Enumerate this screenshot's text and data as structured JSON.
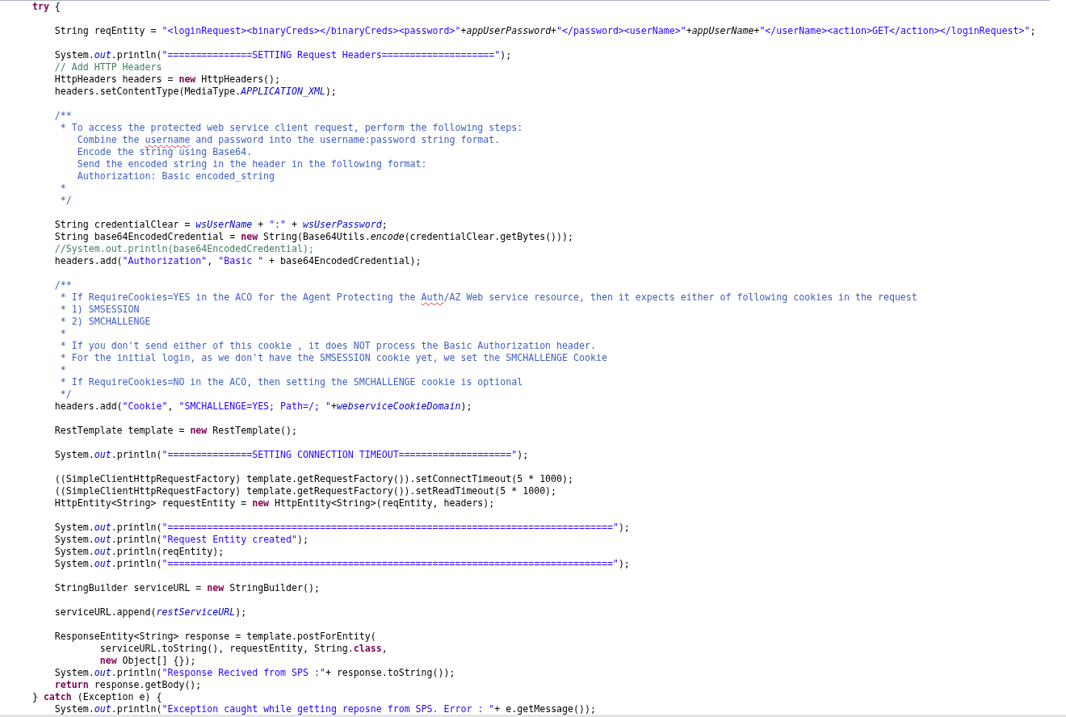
{
  "editor": {
    "lines": [
      {
        "kind": "code",
        "tokens": [
          {
            "kind": "keyword",
            "text": "    try"
          },
          {
            "kind": "plain",
            "text": " {"
          }
        ]
      },
      {
        "kind": "blank"
      },
      {
        "kind": "code",
        "tokens": [
          {
            "kind": "plain",
            "text": "        String reqEntity = "
          },
          {
            "kind": "string",
            "text": "\"<loginRequest><binaryCreds></binaryCreds><password>\""
          },
          {
            "kind": "plain",
            "text": "+"
          },
          {
            "kind": "italic",
            "text": "appUserPassword"
          },
          {
            "kind": "plain",
            "text": "+"
          },
          {
            "kind": "string",
            "text": "\"</password><userName>\""
          },
          {
            "kind": "plain",
            "text": "+"
          },
          {
            "kind": "italic",
            "text": "appUserName"
          },
          {
            "kind": "plain",
            "text": "+"
          },
          {
            "kind": "string",
            "text": "\"</userName><action>GET</action></loginRequest>\""
          },
          {
            "kind": "plain",
            "text": ";"
          }
        ]
      },
      {
        "kind": "blank"
      },
      {
        "kind": "code",
        "tokens": [
          {
            "kind": "plain",
            "text": "        System."
          },
          {
            "kind": "field",
            "text": "out"
          },
          {
            "kind": "plain",
            "text": ".println("
          },
          {
            "kind": "string",
            "text": "\"===============SETTING Request Headers====================\""
          },
          {
            "kind": "plain",
            "text": ");"
          }
        ]
      },
      {
        "kind": "code",
        "tokens": [
          {
            "kind": "comment",
            "text": "        // Add HTTP Headers"
          }
        ]
      },
      {
        "kind": "code",
        "tokens": [
          {
            "kind": "plain",
            "text": "        HttpHeaders headers = "
          },
          {
            "kind": "keyword",
            "text": "new"
          },
          {
            "kind": "plain",
            "text": " HttpHeaders();"
          }
        ]
      },
      {
        "kind": "code",
        "tokens": [
          {
            "kind": "plain",
            "text": "        headers.setContentType(MediaType."
          },
          {
            "kind": "field",
            "text": "APPLICATION_XML"
          },
          {
            "kind": "plain",
            "text": ");"
          }
        ]
      },
      {
        "kind": "blank"
      },
      {
        "kind": "code",
        "tokens": [
          {
            "kind": "javadoc",
            "text": "        /**"
          }
        ]
      },
      {
        "kind": "code",
        "tokens": [
          {
            "kind": "javadoc",
            "text": "         * To access the protected web service client request, perform the following steps:"
          }
        ]
      },
      {
        "kind": "code",
        "tokens": [
          {
            "kind": "javadoc",
            "text": "            Combine the "
          },
          {
            "kind": "typo",
            "text": "username"
          },
          {
            "kind": "javadoc",
            "text": " and password into the username:password string format."
          }
        ]
      },
      {
        "kind": "code",
        "tokens": [
          {
            "kind": "javadoc",
            "text": "            Encode the string using Base64."
          }
        ]
      },
      {
        "kind": "code",
        "tokens": [
          {
            "kind": "javadoc",
            "text": "            Send the encoded string in the header in the following format:"
          }
        ]
      },
      {
        "kind": "code",
        "tokens": [
          {
            "kind": "javadoc",
            "text": "            Authorization: Basic encoded_string"
          }
        ]
      },
      {
        "kind": "code",
        "tokens": [
          {
            "kind": "javadoc",
            "text": "         *"
          }
        ]
      },
      {
        "kind": "code",
        "tokens": [
          {
            "kind": "javadoc",
            "text": "         */"
          }
        ]
      },
      {
        "kind": "blank"
      },
      {
        "kind": "code",
        "tokens": [
          {
            "kind": "plain",
            "text": "        String credentialClear = "
          },
          {
            "kind": "field",
            "text": "wsUserName"
          },
          {
            "kind": "plain",
            "text": " + "
          },
          {
            "kind": "string",
            "text": "\":\""
          },
          {
            "kind": "plain",
            "text": " + "
          },
          {
            "kind": "field",
            "text": "wsUserPassword"
          },
          {
            "kind": "plain",
            "text": ";"
          }
        ]
      },
      {
        "kind": "code",
        "tokens": [
          {
            "kind": "plain",
            "text": "        String base64EncodedCredential = "
          },
          {
            "kind": "keyword",
            "text": "new"
          },
          {
            "kind": "plain",
            "text": " String(Base64Utils."
          },
          {
            "kind": "italic",
            "text": "encode"
          },
          {
            "kind": "plain",
            "text": "(credentialClear.getBytes()));"
          }
        ]
      },
      {
        "kind": "code",
        "tokens": [
          {
            "kind": "comment",
            "text": "        //System.out.println(base64EncodedCredential);"
          }
        ]
      },
      {
        "kind": "code",
        "tokens": [
          {
            "kind": "plain",
            "text": "        headers.add("
          },
          {
            "kind": "string",
            "text": "\"Authorization\""
          },
          {
            "kind": "plain",
            "text": ", "
          },
          {
            "kind": "string",
            "text": "\"Basic \""
          },
          {
            "kind": "plain",
            "text": " + base64EncodedCredential);"
          }
        ]
      },
      {
        "kind": "blank"
      },
      {
        "kind": "code",
        "tokens": [
          {
            "kind": "javadoc",
            "text": "        /**"
          }
        ]
      },
      {
        "kind": "code",
        "tokens": [
          {
            "kind": "javadoc",
            "text": "         * If RequireCookies=YES in the ACO for the Agent Protecting the "
          },
          {
            "kind": "typo",
            "text": "Auth"
          },
          {
            "kind": "javadoc",
            "text": "/AZ Web service resource, then it expects either of following cookies in the request"
          }
        ]
      },
      {
        "kind": "code",
        "tokens": [
          {
            "kind": "javadoc",
            "text": "         * 1) SMSESSION"
          }
        ]
      },
      {
        "kind": "code",
        "tokens": [
          {
            "kind": "javadoc",
            "text": "         * 2) SMCHALLENGE"
          }
        ]
      },
      {
        "kind": "code",
        "tokens": [
          {
            "kind": "javadoc",
            "text": "         *"
          }
        ]
      },
      {
        "kind": "code",
        "tokens": [
          {
            "kind": "javadoc",
            "text": "         * If you don't send either of this cookie , it does NOT process the Basic Authorization header."
          }
        ]
      },
      {
        "kind": "code",
        "tokens": [
          {
            "kind": "javadoc",
            "text": "         * For the initial login, as we don't have the SMSESSION cookie yet, we set the SMCHALLENGE Cookie"
          }
        ]
      },
      {
        "kind": "code",
        "tokens": [
          {
            "kind": "javadoc",
            "text": "         *"
          }
        ]
      },
      {
        "kind": "code",
        "tokens": [
          {
            "kind": "javadoc",
            "text": "         * If RequireCookies=NO in the ACO, then setting the SMCHALLENGE cookie is optional"
          }
        ]
      },
      {
        "kind": "code",
        "tokens": [
          {
            "kind": "javadoc",
            "text": "         */"
          }
        ]
      },
      {
        "kind": "code",
        "tokens": [
          {
            "kind": "plain",
            "text": "        headers.add("
          },
          {
            "kind": "string",
            "text": "\"Cookie\""
          },
          {
            "kind": "plain",
            "text": ", "
          },
          {
            "kind": "string",
            "text": "\"SMCHALLENGE=YES; Path=/; \""
          },
          {
            "kind": "plain",
            "text": "+"
          },
          {
            "kind": "field",
            "text": "webserviceCookieDomain"
          },
          {
            "kind": "plain",
            "text": ");"
          }
        ]
      },
      {
        "kind": "blank"
      },
      {
        "kind": "code",
        "tokens": [
          {
            "kind": "plain",
            "text": "        RestTemplate template = "
          },
          {
            "kind": "keyword",
            "text": "new"
          },
          {
            "kind": "plain",
            "text": " RestTemplate();"
          }
        ]
      },
      {
        "kind": "blank"
      },
      {
        "kind": "code",
        "tokens": [
          {
            "kind": "plain",
            "text": "        System."
          },
          {
            "kind": "field",
            "text": "out"
          },
          {
            "kind": "plain",
            "text": ".println("
          },
          {
            "kind": "string",
            "text": "\"===============SETTING CONNECTION TIMEOUT====================\""
          },
          {
            "kind": "plain",
            "text": ");"
          }
        ]
      },
      {
        "kind": "blank"
      },
      {
        "kind": "code",
        "tokens": [
          {
            "kind": "plain",
            "text": "        ((SimpleClientHttpRequestFactory) template.getRequestFactory()).setConnectTimeout(5 * 1000);"
          }
        ]
      },
      {
        "kind": "code",
        "tokens": [
          {
            "kind": "plain",
            "text": "        ((SimpleClientHttpRequestFactory) template.getRequestFactory()).setReadTimeout(5 * 1000);"
          }
        ]
      },
      {
        "kind": "code",
        "tokens": [
          {
            "kind": "plain",
            "text": "        HttpEntity<String> requestEntity = "
          },
          {
            "kind": "keyword",
            "text": "new"
          },
          {
            "kind": "plain",
            "text": " HttpEntity<String>(reqEntity, headers);"
          }
        ]
      },
      {
        "kind": "blank"
      },
      {
        "kind": "code",
        "tokens": [
          {
            "kind": "plain",
            "text": "        System."
          },
          {
            "kind": "field",
            "text": "out"
          },
          {
            "kind": "plain",
            "text": ".println("
          },
          {
            "kind": "string",
            "text": "\"===============================================================================\""
          },
          {
            "kind": "plain",
            "text": ");"
          }
        ]
      },
      {
        "kind": "code",
        "tokens": [
          {
            "kind": "plain",
            "text": "        System."
          },
          {
            "kind": "field",
            "text": "out"
          },
          {
            "kind": "plain",
            "text": ".println("
          },
          {
            "kind": "string",
            "text": "\"Request Entity created\""
          },
          {
            "kind": "plain",
            "text": ");"
          }
        ]
      },
      {
        "kind": "code",
        "tokens": [
          {
            "kind": "plain",
            "text": "        System."
          },
          {
            "kind": "field",
            "text": "out"
          },
          {
            "kind": "plain",
            "text": ".println(reqEntity);"
          }
        ]
      },
      {
        "kind": "code",
        "tokens": [
          {
            "kind": "plain",
            "text": "        System."
          },
          {
            "kind": "field",
            "text": "out"
          },
          {
            "kind": "plain",
            "text": ".println("
          },
          {
            "kind": "string",
            "text": "\"===============================================================================\""
          },
          {
            "kind": "plain",
            "text": ");"
          }
        ]
      },
      {
        "kind": "blank"
      },
      {
        "kind": "code",
        "tokens": [
          {
            "kind": "plain",
            "text": "        StringBuilder serviceURL = "
          },
          {
            "kind": "keyword",
            "text": "new"
          },
          {
            "kind": "plain",
            "text": " StringBuilder();"
          }
        ]
      },
      {
        "kind": "blank"
      },
      {
        "kind": "code",
        "tokens": [
          {
            "kind": "plain",
            "text": "        serviceURL.append("
          },
          {
            "kind": "field",
            "text": "restServiceURL"
          },
          {
            "kind": "plain",
            "text": ");"
          }
        ]
      },
      {
        "kind": "blank"
      },
      {
        "kind": "code",
        "tokens": [
          {
            "kind": "plain",
            "text": "        ResponseEntity<String> response = template.postForEntity("
          }
        ]
      },
      {
        "kind": "code",
        "tokens": [
          {
            "kind": "plain",
            "text": "                serviceURL.toString(), requestEntity, String."
          },
          {
            "kind": "keyword",
            "text": "class"
          },
          {
            "kind": "plain",
            "text": ","
          }
        ]
      },
      {
        "kind": "code",
        "tokens": [
          {
            "kind": "keyword",
            "text": "                new"
          },
          {
            "kind": "plain",
            "text": " Object[] {});"
          }
        ]
      },
      {
        "kind": "code",
        "tokens": [
          {
            "kind": "plain",
            "text": "        System."
          },
          {
            "kind": "field",
            "text": "out"
          },
          {
            "kind": "plain",
            "text": ".println("
          },
          {
            "kind": "string",
            "text": "\"Response Recived from SPS :\""
          },
          {
            "kind": "plain",
            "text": "+ response.toString());"
          }
        ]
      },
      {
        "kind": "code",
        "tokens": [
          {
            "kind": "keyword",
            "text": "        return"
          },
          {
            "kind": "plain",
            "text": " response.getBody();"
          }
        ]
      },
      {
        "kind": "code",
        "tokens": [
          {
            "kind": "plain",
            "text": "    } "
          },
          {
            "kind": "keyword",
            "text": "catch"
          },
          {
            "kind": "plain",
            "text": " (Exception e) {"
          }
        ]
      },
      {
        "kind": "code",
        "tokens": [
          {
            "kind": "plain",
            "text": "        System."
          },
          {
            "kind": "field",
            "text": "out"
          },
          {
            "kind": "plain",
            "text": ".println("
          },
          {
            "kind": "string",
            "text": "\"Exception caught while getting reposne from SPS. Error : \""
          },
          {
            "kind": "plain",
            "text": "+ e.getMessage());"
          }
        ]
      }
    ]
  }
}
